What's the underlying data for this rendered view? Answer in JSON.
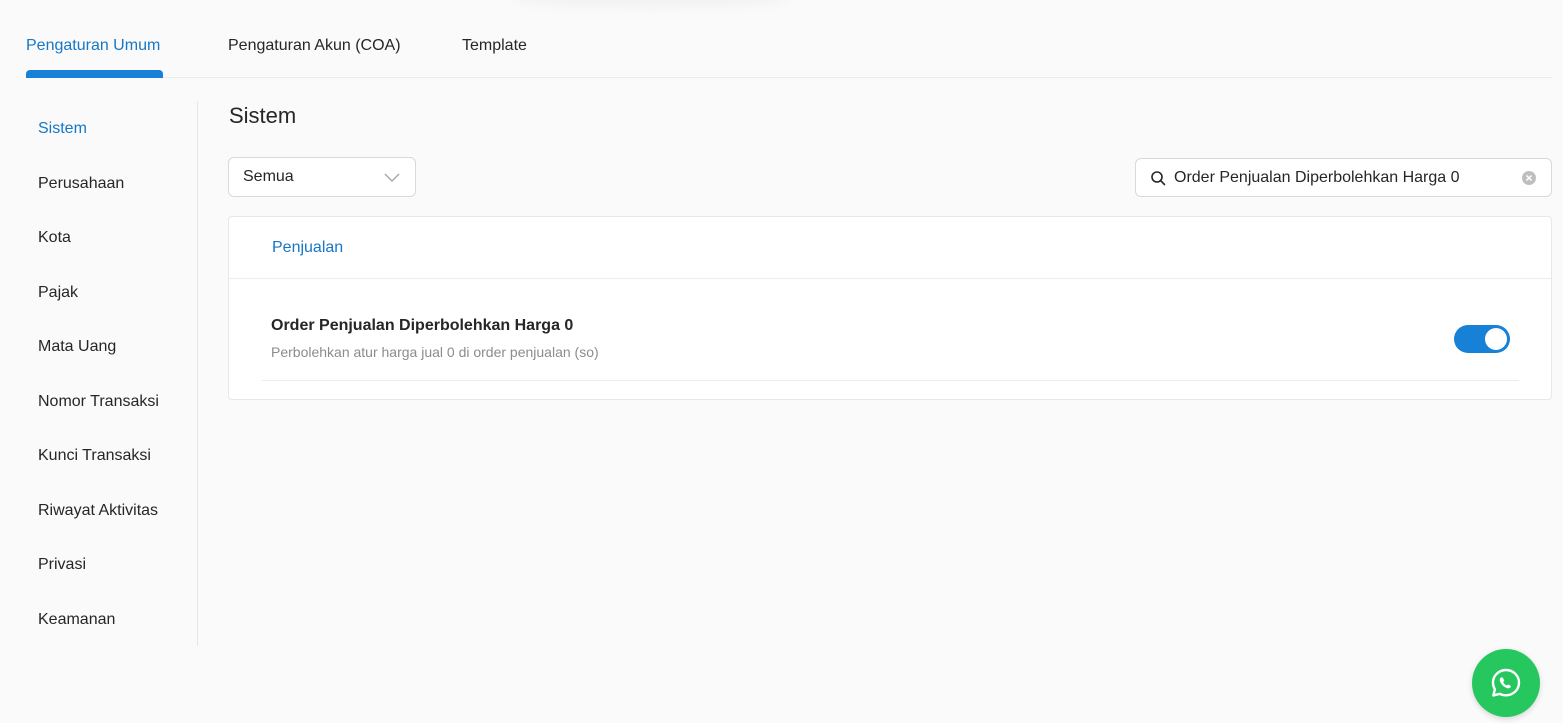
{
  "tabs": [
    {
      "label": "Pengaturan Umum",
      "active": true
    },
    {
      "label": "Pengaturan Akun (COA)",
      "active": false
    },
    {
      "label": "Template",
      "active": false
    }
  ],
  "sidebar": {
    "items": [
      {
        "label": "Sistem",
        "active": true
      },
      {
        "label": "Perusahaan"
      },
      {
        "label": "Kota"
      },
      {
        "label": "Pajak"
      },
      {
        "label": "Mata Uang"
      },
      {
        "label": "Nomor Transaksi"
      },
      {
        "label": "Kunci Transaksi"
      },
      {
        "label": "Riwayat Aktivitas"
      },
      {
        "label": "Privasi"
      },
      {
        "label": "Keamanan"
      }
    ]
  },
  "main": {
    "title": "Sistem",
    "filter": {
      "selected": "Semua"
    },
    "search": {
      "value": "Order Penjualan Diperbolehkan Harga 0"
    },
    "section": {
      "title": "Penjualan",
      "settings": [
        {
          "title": "Order Penjualan Diperbolehkan Harga 0",
          "description": "Perbolehkan atur harga jual 0 di order penjualan (so)",
          "enabled": true
        }
      ]
    }
  },
  "colors": {
    "accent": "#1681d6",
    "active_text": "#1677c6",
    "whatsapp": "#27c75f"
  },
  "icons": {
    "filter_dropdown": "chevron-down-icon",
    "search": "search-icon",
    "clear": "clear-icon",
    "fab": "whatsapp-icon"
  }
}
